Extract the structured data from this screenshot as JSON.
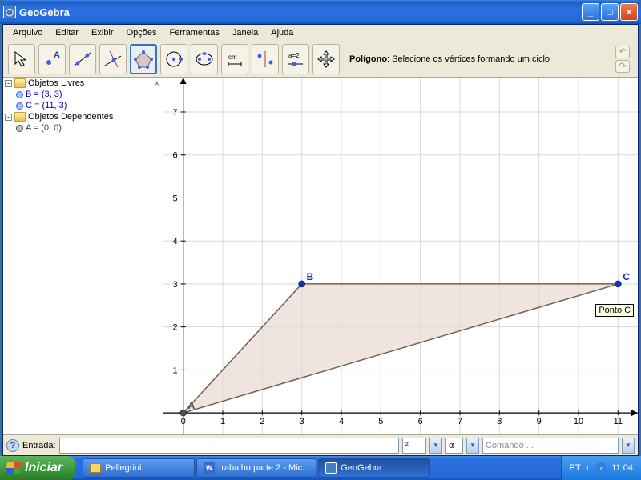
{
  "window": {
    "title": "GeoGebra"
  },
  "menu": {
    "arquivo": "Arquivo",
    "editar": "Editar",
    "exibir": "Exibir",
    "opcoes": "Opções",
    "ferramentas": "Ferramentas",
    "janela": "Janela",
    "ajuda": "Ajuda"
  },
  "tool_hint": {
    "name": "Polígono",
    "desc": ": Selecione os vértices formando um ciclo"
  },
  "algebra": {
    "free": "Objetos Livres",
    "dep": "Objetos Dependentes",
    "B": "B = (3, 3)",
    "C": "C = (11, 3)",
    "A": "A = (0, 0)"
  },
  "chart_data": {
    "type": "scatter",
    "title": "",
    "xlabel": "",
    "ylabel": "",
    "xlim": [
      -0.5,
      11.5
    ],
    "ylim": [
      -0.5,
      7.8
    ],
    "xticks": [
      0,
      1,
      2,
      3,
      4,
      5,
      6,
      7,
      8,
      9,
      10,
      11
    ],
    "yticks": [
      0,
      1,
      2,
      3,
      4,
      5,
      6,
      7
    ],
    "points": [
      {
        "name": "A",
        "x": 0,
        "y": 0,
        "color": "#505050"
      },
      {
        "name": "B",
        "x": 3,
        "y": 3,
        "color": "#1030d0"
      },
      {
        "name": "C",
        "x": 11,
        "y": 3,
        "color": "#1030d0"
      }
    ],
    "polygon": [
      [
        0,
        0
      ],
      [
        3,
        3
      ],
      [
        11,
        3
      ]
    ],
    "fill": "#e8d8d0",
    "tooltip": "Ponto C"
  },
  "inputbar": {
    "label": "Entrada:",
    "sym": "²",
    "greek": "α",
    "cmd": "Comando ..."
  },
  "taskbar": {
    "start": "Iniciar",
    "items": [
      "Pellegrini",
      "trabalho parte 2 - Mic...",
      "GeoGebra"
    ],
    "lang": "PT",
    "clock": "11:04"
  }
}
